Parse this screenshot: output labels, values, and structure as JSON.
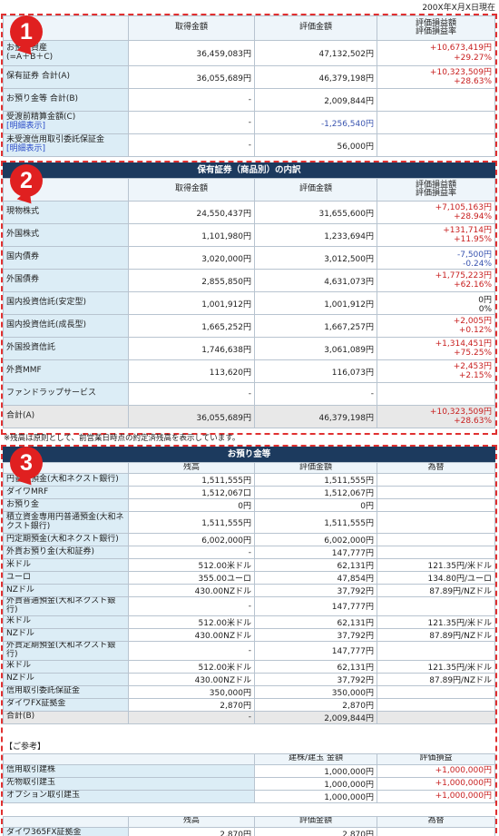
{
  "header": {
    "date": "200X年X月X日現在"
  },
  "badges": [
    "1",
    "2",
    "3"
  ],
  "summary": {
    "cols": [
      "",
      "取得金額",
      "評価金額",
      "評価損益額\n評価損益率"
    ],
    "rows": [
      {
        "label": "お預り資産\n(=A＋B＋C)",
        "link": "",
        "acq": "36,459,083円",
        "val": "47,132,502円",
        "pl": "+10,673,419円\n+29.27%",
        "pl_class": "pos",
        "val_class": ""
      },
      {
        "label": "保有証券 合計(A)",
        "link": "",
        "acq": "36,055,689円",
        "val": "46,379,198円",
        "pl": "+10,323,509円\n+28.63%",
        "pl_class": "pos",
        "val_class": ""
      },
      {
        "label": "お預り金等 合計(B)",
        "link": "",
        "acq": "-",
        "val": "2,009,844円",
        "pl": "",
        "pl_class": "",
        "val_class": ""
      },
      {
        "label": "受渡前精算金額(C)",
        "link": "[明細表示]",
        "acq": "-",
        "val": "-1,256,540円",
        "pl": "",
        "pl_class": "",
        "val_class": "neg"
      },
      {
        "label": "未受渡信用取引委託保証金",
        "link": "[明細表示]",
        "acq": "-",
        "val": "56,000円",
        "pl": "",
        "pl_class": "",
        "val_class": ""
      }
    ]
  },
  "holdings": {
    "title": "保有証券（商品別）の内訳",
    "cols": [
      "",
      "取得金額",
      "評価金額",
      "評価損益額\n評価損益率"
    ],
    "rows": [
      {
        "label": "現物株式",
        "acq": "24,550,437円",
        "val": "31,655,600円",
        "pl": "+7,105,163円\n+28.94%",
        "pl_class": "pos"
      },
      {
        "label": "外国株式",
        "acq": "1,101,980円",
        "val": "1,233,694円",
        "pl": "+131,714円\n+11.95%",
        "pl_class": "pos"
      },
      {
        "label": "国内債券",
        "acq": "3,020,000円",
        "val": "3,012,500円",
        "pl": "-7,500円\n-0.24%",
        "pl_class": "neg"
      },
      {
        "label": "外国債券",
        "acq": "2,855,850円",
        "val": "4,631,073円",
        "pl": "+1,775,223円\n+62.16%",
        "pl_class": "pos"
      },
      {
        "label": "国内投資信託(安定型)",
        "acq": "1,001,912円",
        "val": "1,001,912円",
        "pl": "0円\n0%",
        "pl_class": ""
      },
      {
        "label": "国内投資信託(成長型)",
        "acq": "1,665,252円",
        "val": "1,667,257円",
        "pl": "+2,005円\n+0.12%",
        "pl_class": "pos"
      },
      {
        "label": "外国投資信託",
        "acq": "1,746,638円",
        "val": "3,061,089円",
        "pl": "+1,314,451円\n+75.25%",
        "pl_class": "pos"
      },
      {
        "label": "外貨MMF",
        "acq": "113,620円",
        "val": "116,073円",
        "pl": "+2,453円\n+2.15%",
        "pl_class": "pos"
      },
      {
        "label": "ファンドラップサービス",
        "acq": "-",
        "val": "-",
        "pl": "",
        "pl_class": ""
      }
    ],
    "total": {
      "label": "合計(A)",
      "acq": "36,055,689円",
      "val": "46,379,198円",
      "pl": "+10,323,509円\n+28.63%"
    },
    "note": "※残高は原則として、前営業日時点の約定済残高を表示しています。"
  },
  "deposits": {
    "title": "お預り金等",
    "cols": [
      "",
      "残高",
      "評価金額",
      "為替"
    ],
    "rows": [
      {
        "label": "円普通預金(大和ネクスト銀行)",
        "bal": "1,511,555円",
        "val": "1,511,555円",
        "fx": ""
      },
      {
        "label": "ダイワMRF",
        "bal": "1,512,067口",
        "val": "1,512,067円",
        "fx": ""
      },
      {
        "label": "お預り金",
        "bal": "0円",
        "val": "0円",
        "fx": ""
      },
      {
        "label": "積立資金専用円普通預金(大和ネクスト銀行)",
        "bal": "1,511,555円",
        "val": "1,511,555円",
        "fx": "",
        "tall": true
      },
      {
        "label": "円定期預金(大和ネクスト銀行)",
        "bal": "6,002,000円",
        "val": "6,002,000円",
        "fx": ""
      },
      {
        "label": "外貨お預り金(大和証券)",
        "bal": "-",
        "val": "147,777円",
        "fx": ""
      },
      {
        "label": "米ドル",
        "bal": "512.00米ドル",
        "val": "62,131円",
        "fx": "121.35円/米ドル"
      },
      {
        "label": "ユーロ",
        "bal": "355.00ユーロ",
        "val": "47,854円",
        "fx": "134.80円/ユーロ"
      },
      {
        "label": "NZドル",
        "bal": "430.00NZドル",
        "val": "37,792円",
        "fx": "87.89円/NZドル"
      },
      {
        "label": "外貨普通預金(大和ネクスト銀行)",
        "bal": "-",
        "val": "147,777円",
        "fx": ""
      },
      {
        "label": "米ドル",
        "bal": "512.00米ドル",
        "val": "62,131円",
        "fx": "121.35円/米ドル"
      },
      {
        "label": "NZドル",
        "bal": "430.00NZドル",
        "val": "37,792円",
        "fx": "87.89円/NZドル"
      },
      {
        "label": "外貨定期預金(大和ネクスト銀行)",
        "bal": "-",
        "val": "147,777円",
        "fx": ""
      },
      {
        "label": "米ドル",
        "bal": "512.00米ドル",
        "val": "62,131円",
        "fx": "121.35円/米ドル"
      },
      {
        "label": "NZドル",
        "bal": "430.00NZドル",
        "val": "37,792円",
        "fx": "87.89円/NZドル"
      },
      {
        "label": "信用取引委託保証金",
        "bal": "350,000円",
        "val": "350,000円",
        "fx": ""
      },
      {
        "label": "ダイワFX証拠金",
        "bal": "2,870円",
        "val": "2,870円",
        "fx": ""
      }
    ],
    "total": {
      "label": "合計(B)",
      "bal": "-",
      "val": "2,009,844円",
      "fx": ""
    },
    "ref_title": "【ご参考】",
    "ref_cols": [
      "",
      "建株/建玉 金額",
      "評価損益"
    ],
    "ref_rows": [
      {
        "label": "信用取引建株",
        "amt": "1,000,000円",
        "pl": "+1,000,000円"
      },
      {
        "label": "先物取引建玉",
        "amt": "1,000,000円",
        "pl": "+1,000,000円"
      },
      {
        "label": "オプション取引建玉",
        "amt": "1,000,000円",
        "pl": "+1,000,000円"
      }
    ],
    "fx365_cols": [
      "",
      "残高",
      "評価金額",
      "為替"
    ],
    "fx365_row": {
      "label": "ダイワ365FX証拠金",
      "bal": "2,870円",
      "val": "2,870円",
      "fx": ""
    }
  },
  "colors": {
    "accent_red": "#e02020",
    "header_navy": "#1c3a5e",
    "label_bg": "#dcedf6",
    "positive": "#c82020",
    "negative": "#3a55b0"
  }
}
